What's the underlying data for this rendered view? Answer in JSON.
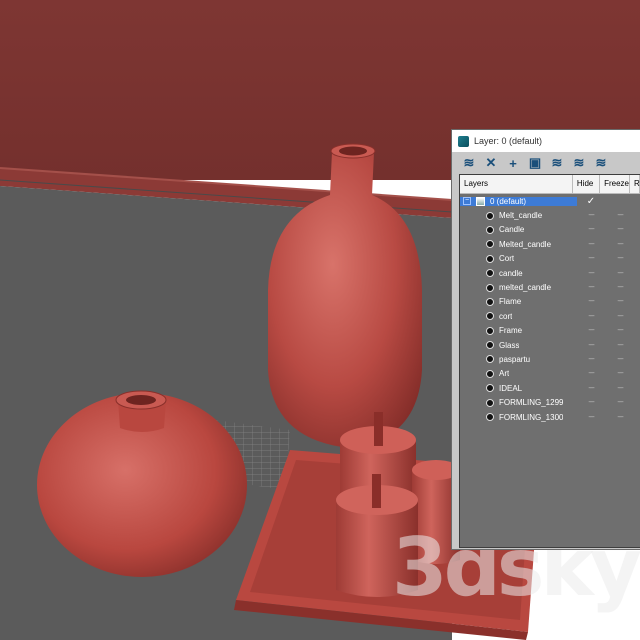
{
  "window": {
    "title": "Layer: 0 (default)"
  },
  "toolbar": {
    "buttons": [
      {
        "icon": "create-layer-icon",
        "glyph": "≋"
      },
      {
        "icon": "delete-layer-icon",
        "glyph": "✕"
      },
      {
        "icon": "add-to-layer-icon",
        "glyph": "+"
      },
      {
        "icon": "select-objects-icon",
        "glyph": "▣"
      },
      {
        "icon": "highlight-layer-icon",
        "glyph": "≋"
      },
      {
        "icon": "hide-all-layers-icon",
        "glyph": "≋"
      },
      {
        "icon": "freeze-all-layers-icon",
        "glyph": "≋"
      }
    ]
  },
  "columns": {
    "layers": "Layers",
    "hide": "Hide",
    "freeze": "Freeze",
    "render": "R"
  },
  "layer": {
    "name": "0 (default)",
    "expand_glyph": "−",
    "active_check": "✓"
  },
  "objects": [
    {
      "label": "Melt_candle"
    },
    {
      "label": "Candle"
    },
    {
      "label": "Melted_candle"
    },
    {
      "label": "Cort"
    },
    {
      "label": "candle"
    },
    {
      "label": "melted_candle"
    },
    {
      "label": "Flame"
    },
    {
      "label": "cort"
    },
    {
      "label": "Frame"
    },
    {
      "label": "Glass"
    },
    {
      "label": "paspartu"
    },
    {
      "label": "Art"
    },
    {
      "label": "IDEAL"
    },
    {
      "label": "FORMLING_1299"
    },
    {
      "label": "FORMLING_1300"
    }
  ],
  "dash_mark": "----",
  "watermark": {
    "text": "3dsky"
  },
  "colors": {
    "wall": "#7a3330",
    "floor": "#5b5b5b",
    "clay": "#c2524a",
    "selection": "#3d7bd6"
  }
}
